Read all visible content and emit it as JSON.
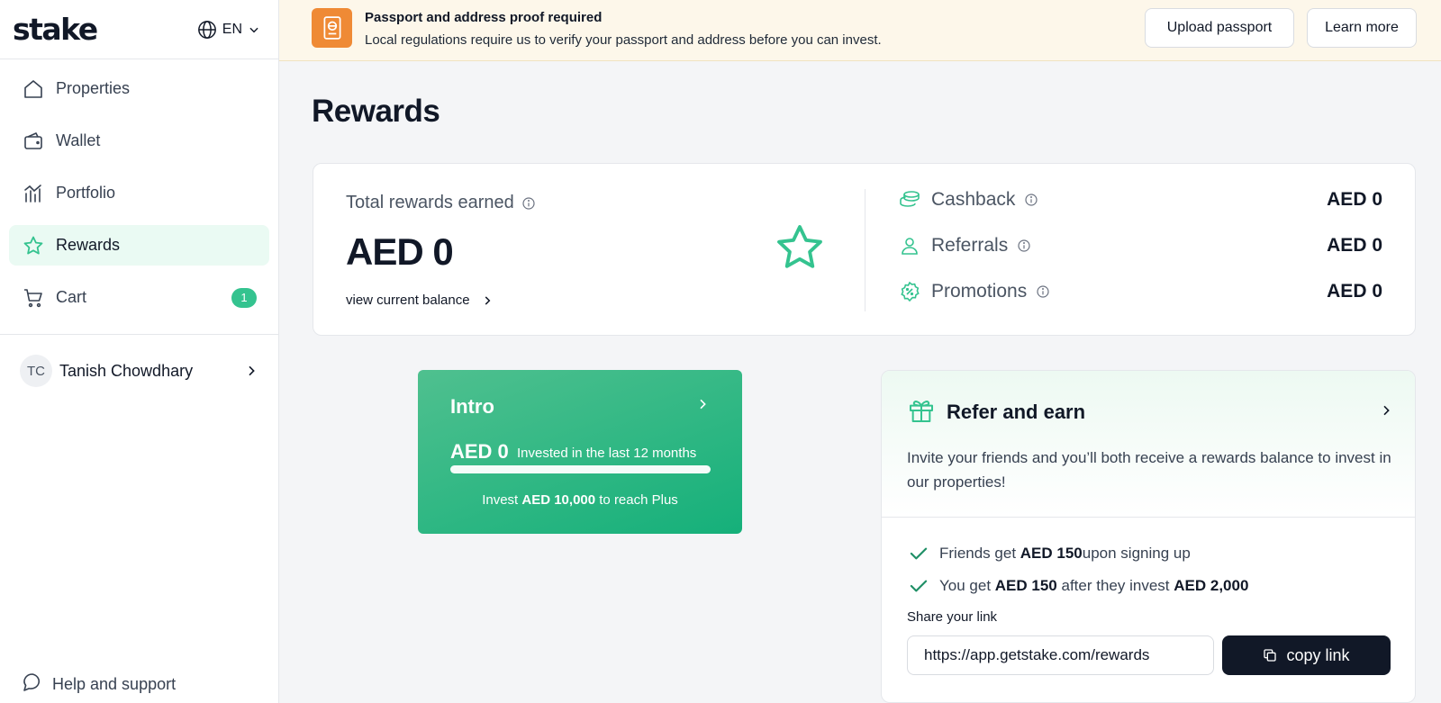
{
  "brand": {
    "logo": "stake",
    "accent": "#34c38f",
    "banner_icon_color": "#ef8a35"
  },
  "lang": {
    "label": "EN"
  },
  "sidebar": {
    "items": [
      {
        "label": "Properties",
        "icon": "home-icon"
      },
      {
        "label": "Wallet",
        "icon": "wallet-icon"
      },
      {
        "label": "Portfolio",
        "icon": "chart-icon"
      },
      {
        "label": "Rewards",
        "icon": "star-icon",
        "active": true
      },
      {
        "label": "Cart",
        "icon": "cart-icon",
        "badge": "1"
      }
    ],
    "user": {
      "initials": "TC",
      "name": "Tanish Chowdhary"
    },
    "help": "Help and support"
  },
  "banner": {
    "title": "Passport and address proof required",
    "text": "Local regulations require us to verify your passport and address before you can invest.",
    "upload_label": "Upload passport",
    "learn_label": "Learn more"
  },
  "page": {
    "title": "Rewards"
  },
  "summary": {
    "label": "Total rewards earned",
    "value": "AED 0",
    "link": "view current balance",
    "breakdown": [
      {
        "name": "Cashback",
        "amount": "AED 0"
      },
      {
        "name": "Referrals",
        "amount": "AED 0"
      },
      {
        "name": "Promotions",
        "amount": "AED 0"
      }
    ]
  },
  "intro": {
    "title": "Intro",
    "amount": "AED 0",
    "subtitle": "Invested in the last 12 months",
    "progress": 0,
    "goal_prefix": "Invest ",
    "goal_amount": "AED 10,000",
    "goal_suffix": " to reach Plus"
  },
  "refer": {
    "title": "Refer and earn",
    "description": "Invite your friends and you’ll both receive a rewards balance to invest in our properties!",
    "perk1": {
      "pre": "Friends get ",
      "amount": "AED 150",
      "post": " upon signing up"
    },
    "perk2": {
      "pre": "You get ",
      "amount": "AED 150",
      "mid": " after they invest ",
      "amount2": "AED 2,000"
    },
    "share_label": "Share your link",
    "share_url": "https://app.getstake.com/rewards",
    "copy_label": "copy link"
  }
}
